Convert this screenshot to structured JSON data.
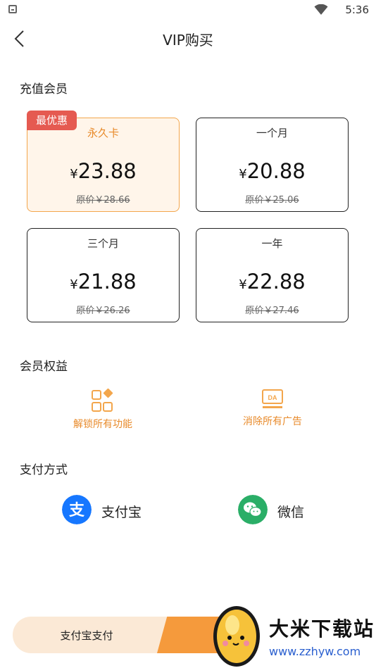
{
  "status_bar": {
    "time": "5:36"
  },
  "header": {
    "title": "VIP购买"
  },
  "recharge": {
    "title": "充值会员",
    "badge": "最优惠",
    "currency": "¥",
    "plans": [
      {
        "name": "永久卡",
        "price": "23.88",
        "original": "原价￥28.66",
        "selected": true
      },
      {
        "name": "一个月",
        "price": "20.88",
        "original": "原价￥25.06",
        "selected": false
      },
      {
        "name": "三个月",
        "price": "21.88",
        "original": "原价￥26.26",
        "selected": false
      },
      {
        "name": "一年",
        "price": "22.88",
        "original": "原价￥27.46",
        "selected": false
      }
    ]
  },
  "benefits": {
    "title": "会员权益",
    "items": [
      {
        "label": "解锁所有功能",
        "icon": "unlock-features-icon"
      },
      {
        "label": "消除所有广告",
        "icon": "no-ads-icon",
        "icon_text": "DA"
      }
    ]
  },
  "payment": {
    "title": "支付方式",
    "methods": [
      {
        "label": "支付宝",
        "icon": "alipay-icon",
        "icon_char": "支",
        "color": "#1677ff"
      },
      {
        "label": "微信",
        "icon": "wechat-icon",
        "color": "#2aae67"
      }
    ]
  },
  "pay_button": {
    "label": "支付宝支付"
  },
  "watermark": {
    "title": "大米下载站",
    "url": "www.zzhyw.com"
  },
  "colors": {
    "accent": "#f3a64c",
    "badge": "#e55a51",
    "selected_bg": "#fff5ea"
  }
}
